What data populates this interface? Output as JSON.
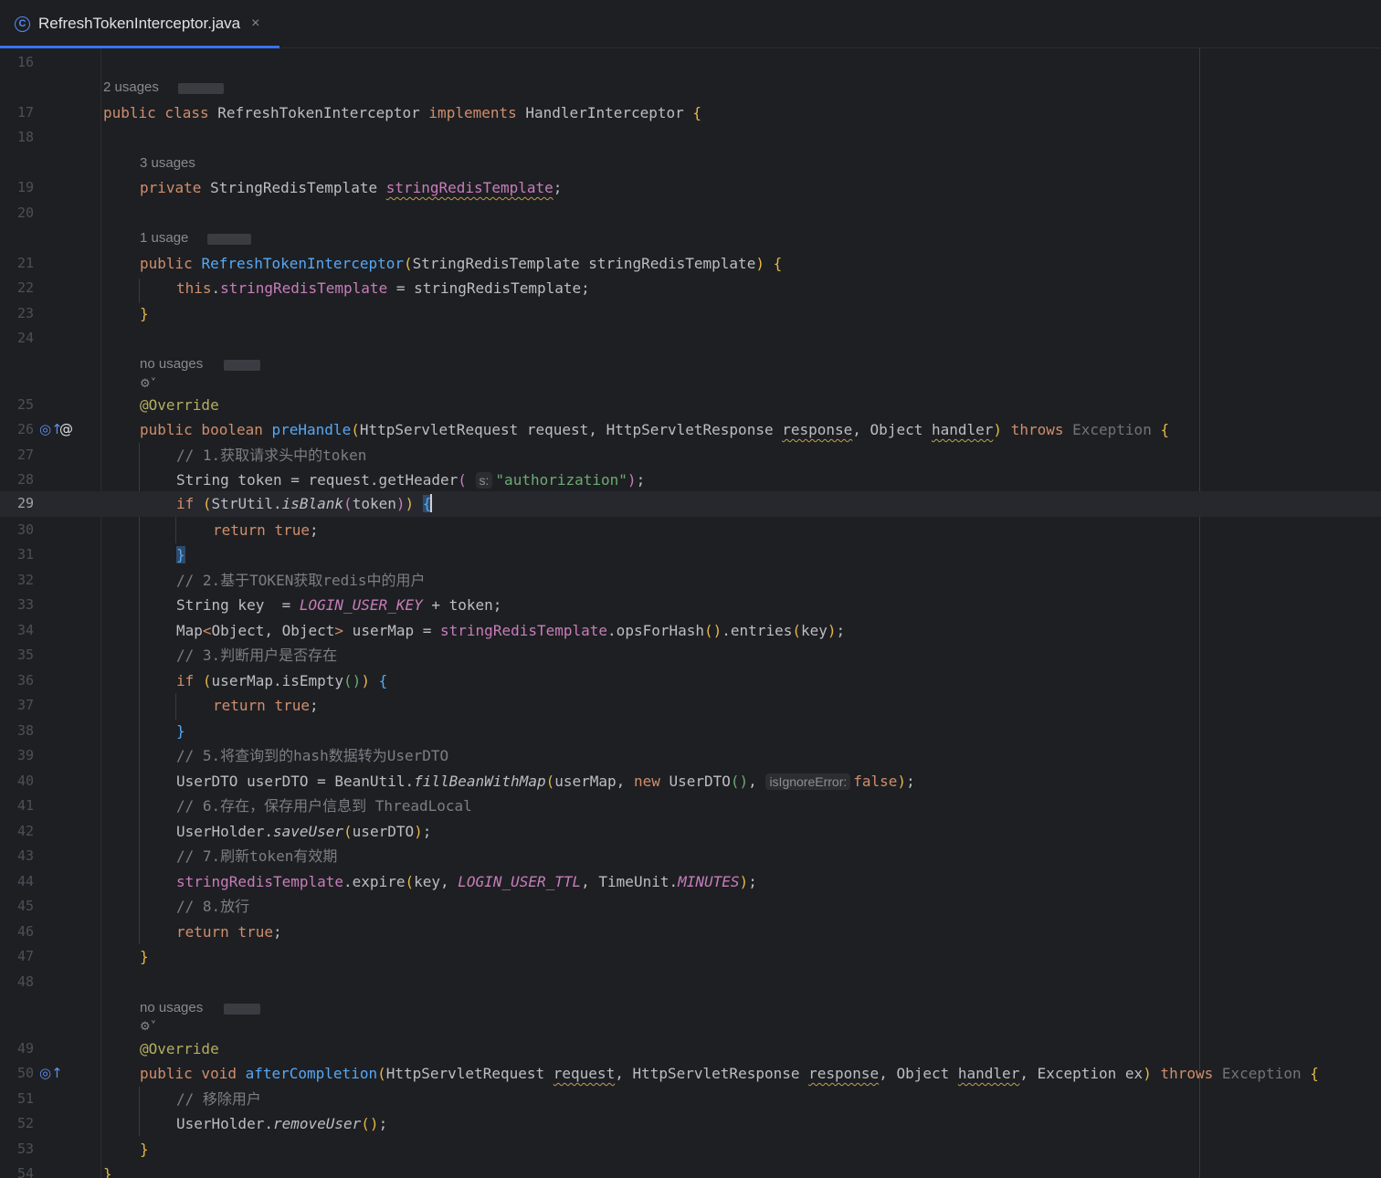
{
  "tab": {
    "file_name": "RefreshTokenInterceptor.java",
    "file_icon": "class-icon",
    "close": "×"
  },
  "usages": {
    "class": "2 usages",
    "field": "3 usages",
    "constructor": "1 usage",
    "prehandle": "no usages",
    "aftercompletion": "no usages"
  },
  "hints": {
    "s": "s:",
    "isIgnoreError": "isIgnoreError:"
  },
  "line_numbers": [
    "16",
    "17",
    "18",
    "19",
    "20",
    "21",
    "22",
    "23",
    "24",
    "25",
    "26",
    "27",
    "28",
    "29",
    "30",
    "31",
    "32",
    "33",
    "34",
    "35",
    "36",
    "37",
    "38",
    "39",
    "40",
    "41",
    "42",
    "43",
    "44",
    "45",
    "46",
    "47",
    "48",
    "49",
    "50",
    "51",
    "52",
    "53",
    "54"
  ],
  "code": {
    "l17": [
      "public class ",
      "RefreshTokenInterceptor ",
      "implements ",
      "HandlerInterceptor ",
      "{"
    ],
    "l19": [
      "private ",
      "StringRedisTemplate ",
      "stringRedisTemplate",
      ";"
    ],
    "l21": [
      "public ",
      "RefreshTokenInterceptor",
      "(",
      "StringRedisTemplate stringRedisTemplate",
      ") ",
      "{"
    ],
    "l22": [
      "this",
      ".",
      "stringRedisTemplate",
      " = stringRedisTemplate;"
    ],
    "l23": [
      "}"
    ],
    "l25": [
      "@Override"
    ],
    "l26": [
      "public boolean ",
      "preHandle",
      "(",
      "HttpServletRequest request, HttpServletResponse ",
      "response",
      ", Object ",
      "handler",
      ") ",
      "throws ",
      "Exception ",
      "{"
    ],
    "l27": [
      "// 1.获取请求头中的token"
    ],
    "l28": [
      "String token = request.getHeader",
      "(",
      "\"authorization\"",
      ")",
      ";"
    ],
    "l29": [
      "if ",
      "(",
      "StrUtil.",
      "isBlank",
      "(",
      "token",
      ")",
      ") ",
      "{"
    ],
    "l30": [
      "return ",
      "true",
      ";"
    ],
    "l31": [
      "}"
    ],
    "l32": [
      "// 2.基于TOKEN获取redis中的用户"
    ],
    "l33": [
      "String key  = ",
      "LOGIN_USER_KEY",
      " + token;"
    ],
    "l34": [
      "Map",
      "<",
      "Object, Object",
      ">",
      " userMap = ",
      "stringRedisTemplate",
      ".opsForHash",
      "()",
      ".entries",
      "(",
      "key",
      ")",
      ";"
    ],
    "l35": [
      "// 3.判断用户是否存在"
    ],
    "l36": [
      "if ",
      "(",
      "userMap.isEmpty",
      "()",
      ") ",
      "{"
    ],
    "l37": [
      "return ",
      "true",
      ";"
    ],
    "l38": [
      "}"
    ],
    "l39": [
      "// 5.将查询到的hash数据转为UserDTO"
    ],
    "l40": [
      "UserDTO userDTO = BeanUtil.",
      "fillBeanWithMap",
      "(",
      "userMap, ",
      "new ",
      "UserDTO",
      "()",
      ", ",
      "false",
      ")",
      ";"
    ],
    "l41": [
      "// 6.存在，保存用户信息到 ThreadLocal"
    ],
    "l42": [
      "UserHolder.",
      "saveUser",
      "(",
      "userDTO",
      ")",
      ";"
    ],
    "l43": [
      "// 7.刷新token有效期"
    ],
    "l44": [
      "stringRedisTemplate",
      ".expire",
      "(",
      "key, ",
      "LOGIN_USER_TTL",
      ", TimeUnit.",
      "MINUTES",
      ")",
      ";"
    ],
    "l45": [
      "// 8.放行"
    ],
    "l46": [
      "return ",
      "true",
      ";"
    ],
    "l47": [
      "}"
    ],
    "l49": [
      "@Override"
    ],
    "l50": [
      "public void ",
      "afterCompletion",
      "(",
      "HttpServletRequest ",
      "request",
      ", HttpServletResponse ",
      "response",
      ", Object ",
      "handler",
      ", Exception ex",
      ") ",
      "throws ",
      "Exception ",
      "{"
    ],
    "l51": [
      "// 移除用户"
    ],
    "l52": [
      "UserHolder.",
      "removeUser",
      "()",
      ";"
    ],
    "l53": [
      "}"
    ],
    "l54": [
      "}"
    ]
  },
  "gutter_icons": {
    "l26": [
      "implement-method-icon",
      "annotation-at-icon"
    ],
    "l50": [
      "implement-method-icon"
    ]
  },
  "glyphs": {
    "override_arrow": "◎↑",
    "at": "@",
    "gear": "⚙˅"
  },
  "colors": {
    "background": "#1e1f22",
    "keyword": "#cf8e6d",
    "method": "#56a8f5",
    "string": "#6aab73",
    "comment": "#7a7e85",
    "field": "#c77dbb",
    "annotation": "#b3ae60",
    "accent": "#3574f0"
  }
}
